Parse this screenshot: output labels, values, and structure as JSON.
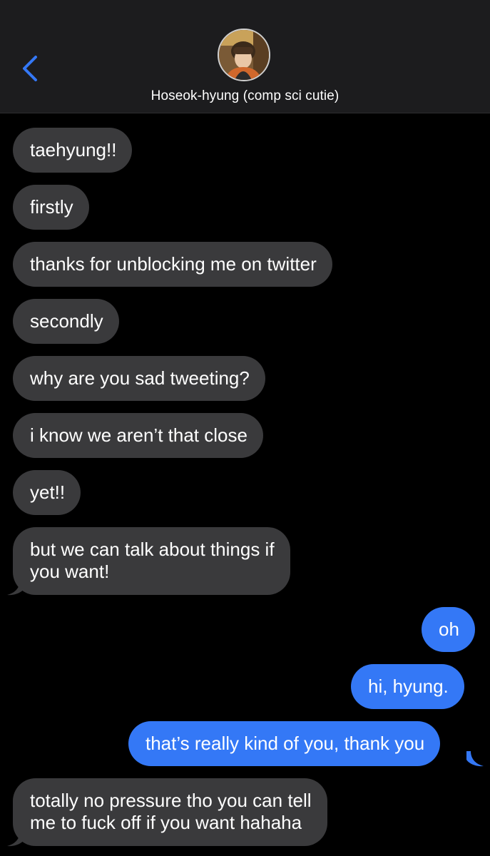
{
  "header": {
    "contact_name": "Hoseok-hyung (comp sci cutie)",
    "back_icon": "chevron-left-icon",
    "accent_color": "#3478f6"
  },
  "messages": [
    {
      "direction": "incoming",
      "text": "taehyung!!"
    },
    {
      "direction": "incoming",
      "text": "firstly"
    },
    {
      "direction": "incoming",
      "text": "thanks for unblocking me on twitter"
    },
    {
      "direction": "incoming",
      "text": "secondly"
    },
    {
      "direction": "incoming",
      "text": "why are you sad tweeting?"
    },
    {
      "direction": "incoming",
      "text": "i know we aren’t that close"
    },
    {
      "direction": "incoming",
      "text": "yet!!"
    },
    {
      "direction": "incoming",
      "lines": [
        "but we can talk about things if",
        "you want!"
      ]
    },
    {
      "direction": "outgoing",
      "text": "oh"
    },
    {
      "direction": "outgoing",
      "text": "hi, hyung."
    },
    {
      "direction": "outgoing",
      "text": "that’s really kind of you, thank you"
    },
    {
      "direction": "incoming",
      "lines": [
        "totally no pressure tho you can tell",
        "me to fuck off if you want hahaha"
      ]
    }
  ],
  "colors": {
    "incoming_bubble": "#3a3a3c",
    "outgoing_bubble": "#3478f6",
    "header_bg": "#1c1c1e",
    "background": "#000000"
  }
}
